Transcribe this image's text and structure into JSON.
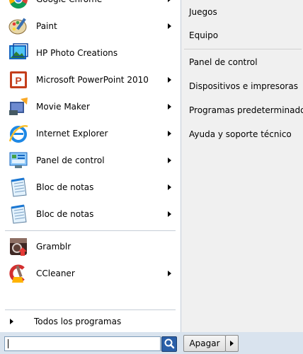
{
  "programs": [
    {
      "label": "Google Chrome",
      "icon": "chrome-icon",
      "has_arrow": true
    },
    {
      "label": "Paint",
      "icon": "paint-icon",
      "has_arrow": true
    },
    {
      "label": "HP Photo Creations",
      "icon": "hp-photo-creations-icon",
      "has_arrow": false
    },
    {
      "label": "Microsoft PowerPoint 2010",
      "icon": "powerpoint-icon",
      "has_arrow": true
    },
    {
      "label": "Movie Maker",
      "icon": "movie-maker-icon",
      "has_arrow": true
    },
    {
      "label": "Internet Explorer",
      "icon": "internet-explorer-icon",
      "has_arrow": true
    },
    {
      "label": "Panel de control",
      "icon": "control-panel-icon",
      "has_arrow": true
    },
    {
      "label": "Bloc de notas",
      "icon": "notepad-icon",
      "has_arrow": true
    },
    {
      "label": "Bloc de notas",
      "icon": "notepad-icon",
      "has_arrow": true
    },
    {
      "label": "Gramblr",
      "icon": "gramblr-icon",
      "has_arrow": false
    },
    {
      "label": "CCleaner",
      "icon": "ccleaner-icon",
      "has_arrow": true
    }
  ],
  "all_programs_label": "Todos los programas",
  "right_items": [
    "Juegos",
    "Equipo",
    "Panel de control",
    "Dispositivos e impresoras",
    "Programas predeterminados",
    "Ayuda y soporte técnico"
  ],
  "search": {
    "value": ""
  },
  "shutdown_label": "Apagar",
  "colors": {
    "left_bg": "#ffffff",
    "right_bg": "#f0f0f0",
    "bottom_bg": "#d9e3ee"
  }
}
